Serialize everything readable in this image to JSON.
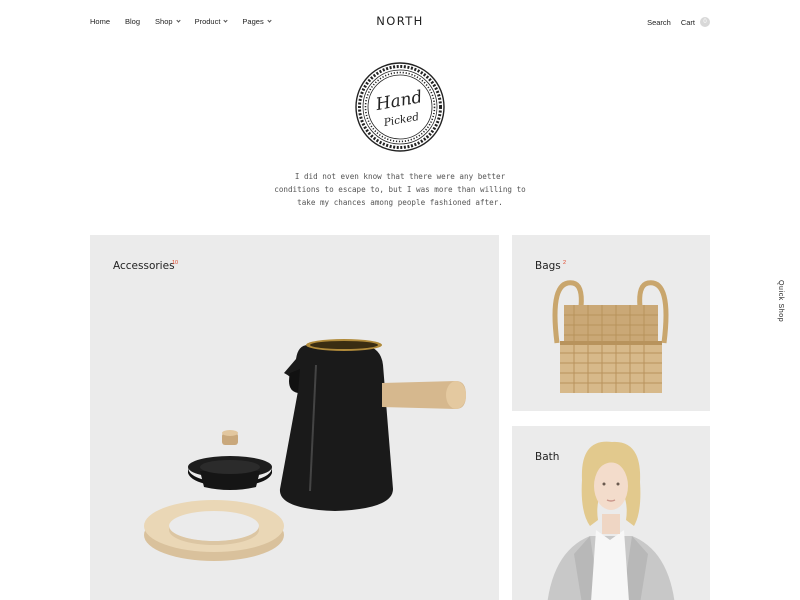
{
  "header": {
    "nav": [
      {
        "label": "Home"
      },
      {
        "label": "Blog"
      },
      {
        "label": "Shop"
      },
      {
        "label": "Product"
      },
      {
        "label": "Pages"
      }
    ],
    "logo": "NORTH",
    "search_label": "Search",
    "cart_label": "Cart",
    "cart_count": "0"
  },
  "badge": {
    "line1": "Hand",
    "line2": "Picked"
  },
  "intro": {
    "line1": "I did not even know that there were any better",
    "line2": "conditions to escape to, but I was more than willing to",
    "line3": "take my chances among people fashioned after."
  },
  "categories": [
    {
      "title": "Accessories",
      "count": "10"
    },
    {
      "title": "Bags",
      "count": "2"
    },
    {
      "title": "Bath",
      "count": ""
    }
  ],
  "side_tab": {
    "label": "Quick Shop"
  },
  "colors": {
    "accent": "#e0472b",
    "tile_bg": "#ebebeb",
    "text": "#222222"
  }
}
